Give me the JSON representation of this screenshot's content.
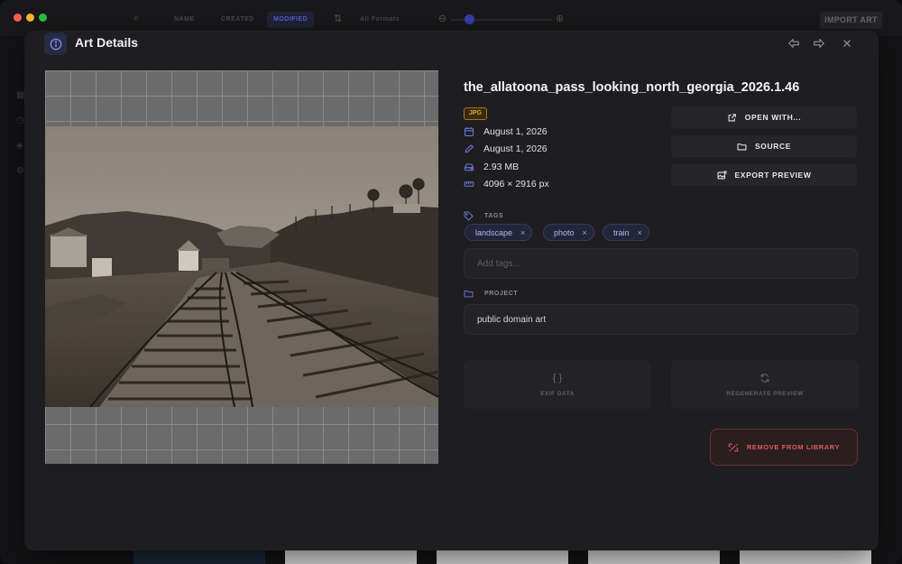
{
  "app": {
    "toolbar": {
      "sort_name": "NAME",
      "sort_created": "CREATED",
      "sort_modified": "MODIFIED",
      "format_filter": "All Formats",
      "import_label": "IMPORT ART"
    }
  },
  "modal": {
    "title": "Art Details",
    "filename": "the_allatoona_pass_looking_north_georgia_2026.1.46",
    "format": "JPG",
    "created": "August 1, 2026",
    "modified": "August 1, 2026",
    "file_size": "2.93 MB",
    "dimensions": "4096 × 2916 px",
    "actions": {
      "open_with": "OPEN WITH...",
      "source": "SOURCE",
      "export_preview": "EXPORT PREVIEW"
    },
    "tags_label": "TAGS",
    "tags": [
      {
        "label": "landscape",
        "remove": "×"
      },
      {
        "label": "photo",
        "remove": "×"
      },
      {
        "label": "train",
        "remove": "×"
      }
    ],
    "tags_placeholder": "Add tags...",
    "project_label": "PROJECT",
    "project_value": "public domain art",
    "tiles": {
      "exif": "EXIF DATA",
      "regenerate": "REGENERATE PREVIEW"
    },
    "remove_label": "REMOVE FROM LIBRARY"
  },
  "colors": {
    "accent": "#6f78e0",
    "danger": "#e25c5c",
    "badge": "#e8a53a"
  }
}
